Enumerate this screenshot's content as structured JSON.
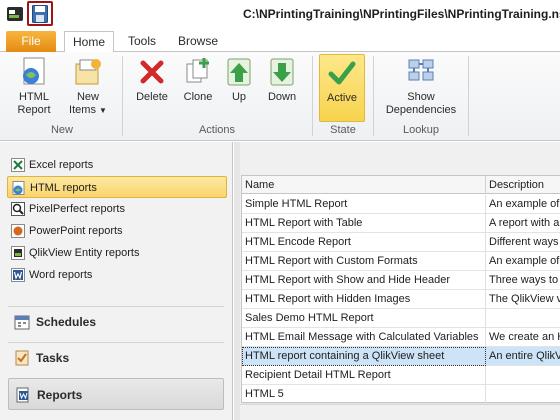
{
  "window": {
    "title": "C:\\NPrintingTraining\\NPrintingFiles\\NPrintingTraining.nsq"
  },
  "quick_access": {
    "save_icon": "save-icon"
  },
  "tabs": [
    {
      "label": "File"
    },
    {
      "label": "Home"
    },
    {
      "label": "Tools"
    },
    {
      "label": "Browse"
    }
  ],
  "ribbon": {
    "groups": {
      "new": "New",
      "actions": "Actions",
      "state": "State",
      "lookup": "Lookup"
    },
    "buttons": {
      "html_report": "HTML Report",
      "new_items": "New Items",
      "delete": "Delete",
      "clone": "Clone",
      "up": "Up",
      "down": "Down",
      "active": "Active",
      "show_dependencies": "Show Dependencies"
    }
  },
  "nav": {
    "report_types": [
      {
        "label": "Excel reports",
        "icon": "excel-icon"
      },
      {
        "label": "HTML reports",
        "icon": "html-icon"
      },
      {
        "label": "PixelPerfect reports",
        "icon": "pixelperfect-icon"
      },
      {
        "label": "PowerPoint reports",
        "icon": "powerpoint-icon"
      },
      {
        "label": "QlikView Entity reports",
        "icon": "qlikview-icon"
      },
      {
        "label": "Word reports",
        "icon": "word-icon"
      }
    ],
    "selected_index": 1,
    "sections": [
      {
        "label": "Schedules"
      },
      {
        "label": "Tasks"
      },
      {
        "label": "Reports"
      }
    ]
  },
  "grid": {
    "columns": [
      "Name",
      "Description"
    ],
    "rows": [
      {
        "name": "Simple HTML Report",
        "description": "An example of a"
      },
      {
        "name": "HTML Report with Table",
        "description": "A report with a"
      },
      {
        "name": "HTML Encode Report",
        "description": "Different ways"
      },
      {
        "name": "HTML Report with Custom Formats",
        "description": "An example of l"
      },
      {
        "name": "HTML Report with Show and Hide Header",
        "description": "Three ways to"
      },
      {
        "name": "HTML Report with Hidden Images",
        "description": "The QlikView va"
      },
      {
        "name": "Sales Demo HTML Report",
        "description": ""
      },
      {
        "name": "HTML Email Message with Calculated Variables",
        "description": "We create an H"
      },
      {
        "name": "HTML report containing a QlikView sheet",
        "description": "An entire QlikV"
      },
      {
        "name": "Recipient Detail HTML Report",
        "description": ""
      },
      {
        "name": "HTML 5",
        "description": ""
      }
    ],
    "selected_row": 8
  },
  "colors": {
    "accent": "#e48a12",
    "selection": "#cde3f7",
    "highlight": "#f9d56c"
  }
}
